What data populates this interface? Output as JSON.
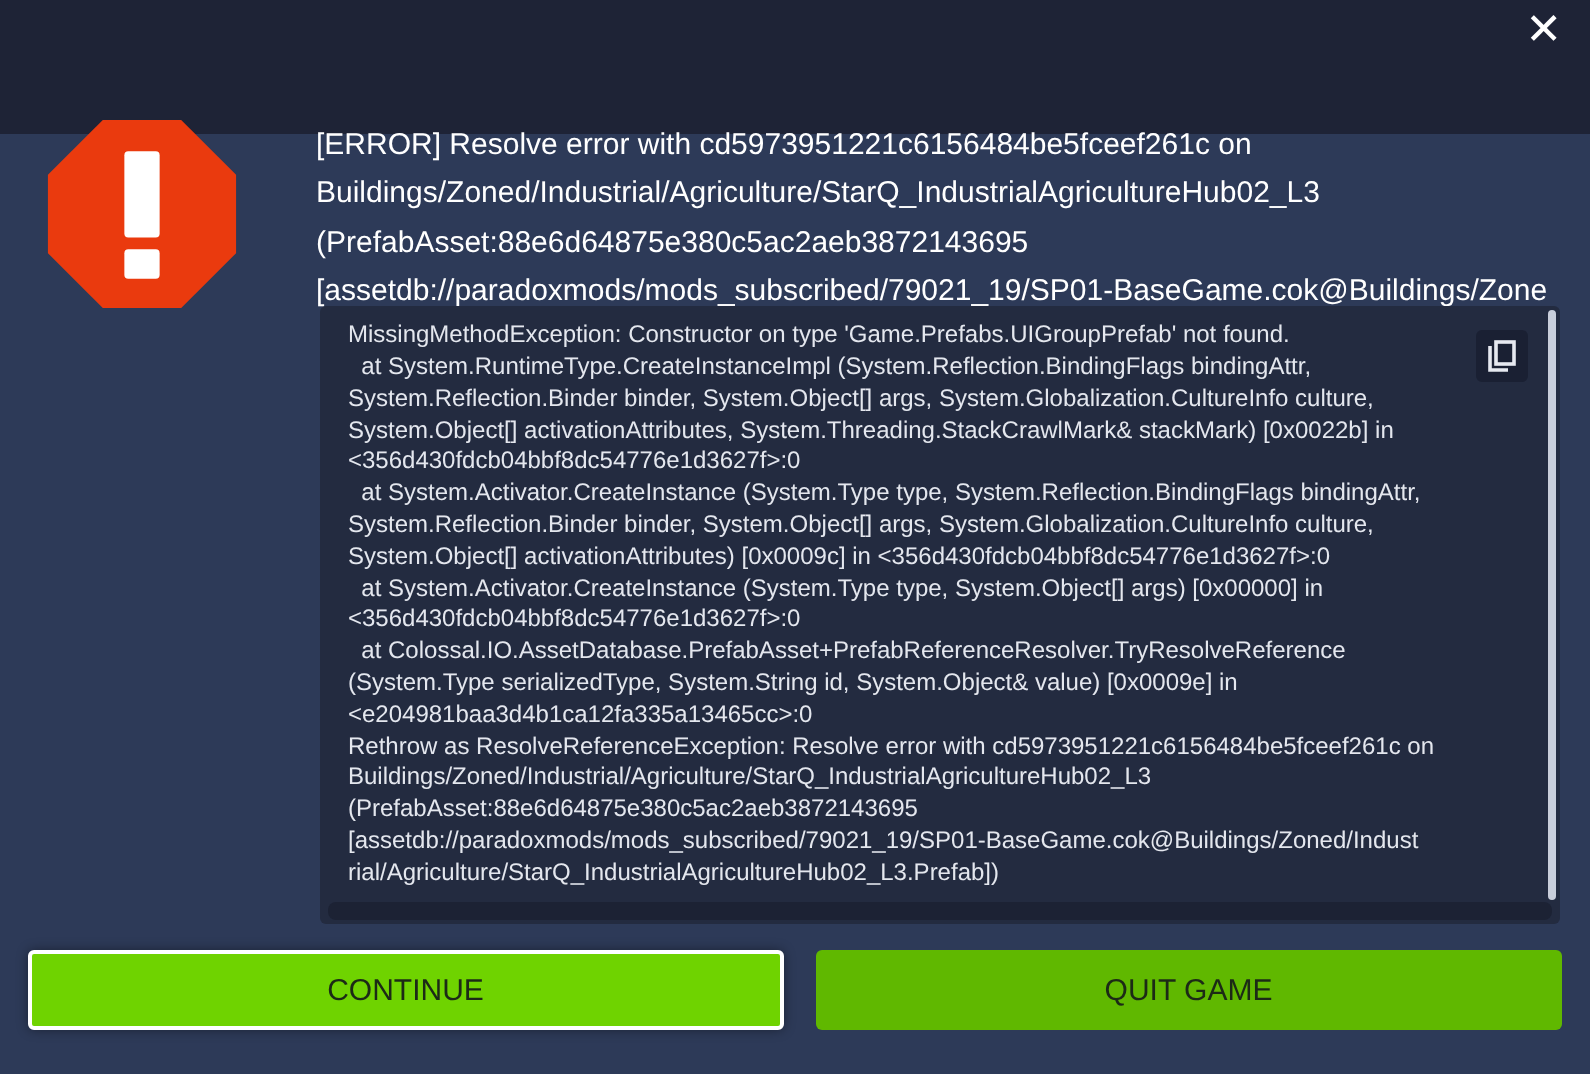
{
  "close_label": "✕",
  "heading_lines": [
    "[ERROR] Resolve error with cd5973951221c6156484be5fceef261c on",
    "Buildings/Zoned/Industrial/Agriculture/StarQ_IndustrialAgricultureHub02_L3",
    "(PrefabAsset:88e6d64875e380c5ac2aeb3872143695",
    "[assetdb://paradoxmods/mods_subscribed/79021_19/SP01-BaseGame.cok@Buildings/Zone"
  ],
  "log_lines": [
    "MissingMethodException: Constructor on type 'Game.Prefabs.UIGroupPrefab' not found.",
    "  at System.RuntimeType.CreateInstanceImpl (System.Reflection.BindingFlags bindingAttr,",
    "System.Reflection.Binder binder, System.Object[] args, System.Globalization.CultureInfo culture,",
    "System.Object[] activationAttributes, System.Threading.StackCrawlMark& stackMark) [0x0022b] in",
    "<356d430fdcb04bbf8dc54776e1d3627f>:0",
    "  at System.Activator.CreateInstance (System.Type type, System.Reflection.BindingFlags bindingAttr,",
    "System.Reflection.Binder binder, System.Object[] args, System.Globalization.CultureInfo culture,",
    "System.Object[] activationAttributes) [0x0009c] in <356d430fdcb04bbf8dc54776e1d3627f>:0",
    "  at System.Activator.CreateInstance (System.Type type, System.Object[] args) [0x00000] in",
    "<356d430fdcb04bbf8dc54776e1d3627f>:0",
    "  at Colossal.IO.AssetDatabase.PrefabAsset+PrefabReferenceResolver.TryResolveReference",
    "(System.Type serializedType, System.String id, System.Object& value) [0x0009e] in",
    "<e204981baa3d4b1ca12fa335a13465cc>:0",
    "Rethrow as ResolveReferenceException: Resolve error with cd5973951221c6156484be5fceef261c on",
    "Buildings/Zoned/Industrial/Agriculture/StarQ_IndustrialAgricultureHub02_L3",
    "(PrefabAsset:88e6d64875e380c5ac2aeb3872143695",
    "[assetdb://paradoxmods/mods_subscribed/79021_19/SP01-BaseGame.cok@Buildings/Zoned/Indust",
    "rial/Agriculture/StarQ_IndustrialAgricultureHub02_L3.Prefab])"
  ],
  "buttons": [
    {
      "label": "CONTINUE",
      "selected": true
    },
    {
      "label": "QUIT GAME",
      "selected": false
    }
  ]
}
